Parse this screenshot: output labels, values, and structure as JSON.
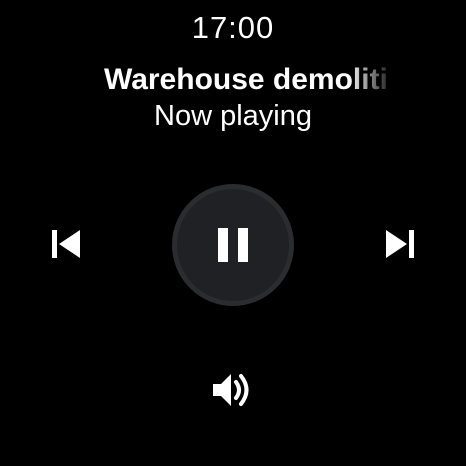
{
  "status": {
    "time": "17:00"
  },
  "track": {
    "title": "Warehouse demoliti",
    "subtitle": "Now playing"
  },
  "controls": {
    "previous_icon": "skip-previous-icon",
    "play_pause_icon": "pause-icon",
    "next_icon": "skip-next-icon",
    "volume_icon": "volume-icon"
  },
  "colors": {
    "background": "#000000",
    "foreground": "#ffffff",
    "play_button_bg": "#202124"
  }
}
